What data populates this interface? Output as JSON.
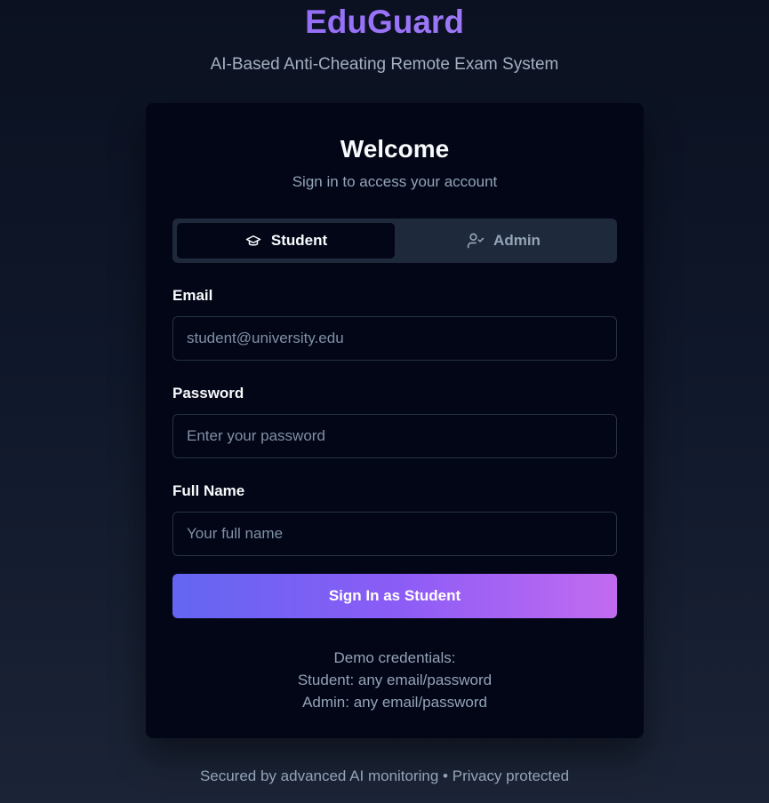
{
  "brand": {
    "title": "EduGuard",
    "tagline": "AI-Based Anti-Cheating Remote Exam System",
    "accent": "#8b5cf6"
  },
  "card": {
    "title": "Welcome",
    "subtitle": "Sign in to access your account"
  },
  "tabs": [
    {
      "label": "Student",
      "icon": "graduation-cap-icon",
      "active": true
    },
    {
      "label": "Admin",
      "icon": "user-check-icon",
      "active": false
    }
  ],
  "form": {
    "email": {
      "label": "Email",
      "placeholder": "student@university.edu",
      "value": ""
    },
    "password": {
      "label": "Password",
      "placeholder": "Enter your password",
      "value": ""
    },
    "full_name": {
      "label": "Full Name",
      "placeholder": "Your full name",
      "value": ""
    },
    "submit_label": "Sign In as Student"
  },
  "demo": {
    "heading": "Demo credentials:",
    "student": "Student: any email/password",
    "admin": "Admin: any email/password"
  },
  "footer": {
    "text": "Secured by advanced AI monitoring • Privacy protected"
  }
}
